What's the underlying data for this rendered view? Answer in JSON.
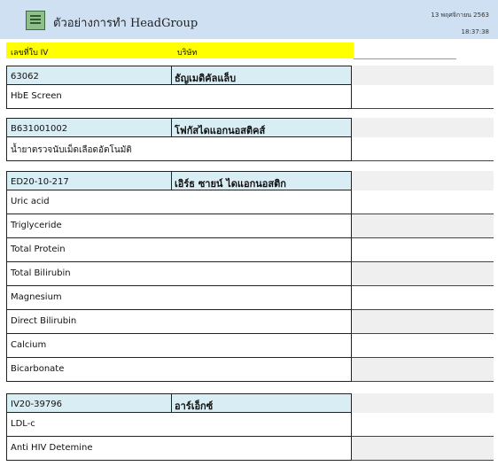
{
  "header": {
    "title": "ตัวอย่างการทำ HeadGroup",
    "date": "13 พฤศจิกายน 2563",
    "time": "18:37:38"
  },
  "columns": {
    "number_label": "เลขที่ใบ IV",
    "company_label": "บริษัท"
  },
  "groups": [
    {
      "number": "63062",
      "company": "ธัญเมดิคัลแล็บ",
      "items": [
        "HbE Screen"
      ]
    },
    {
      "number": "B631001002",
      "company": "โฟกัสไดแอกนอสติคส์",
      "items": [
        "น้ำยาตรวจนับเม็ดเลือดอัตโนมัติ"
      ]
    },
    {
      "number": "ED20-10-217",
      "company": "เอิร์ธ ซายน์ ไดแอกนอสติก",
      "items": [
        "Uric acid",
        "Triglyceride",
        "Total Protein",
        "Total Bilirubin",
        "Magnesium",
        "Direct Bilirubin",
        "Calcium",
        "Bicarbonate"
      ]
    },
    {
      "number": "IV20-39796",
      "company": "อาร์เอ็กซ์",
      "items": [
        "LDL-c",
        "Anti HIV Detemine"
      ]
    }
  ]
}
